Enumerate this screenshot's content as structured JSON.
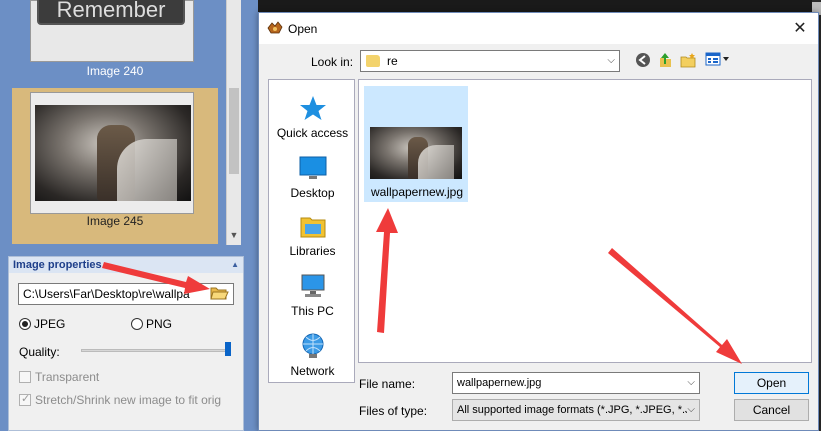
{
  "background_app": {
    "thumbnails": [
      {
        "label": "Image 240",
        "banner_text": "Remember"
      },
      {
        "label": "Image 245"
      }
    ],
    "image_properties": {
      "title": "Image properties",
      "path_value": "C:\\Users\\Far\\Desktop\\re\\wallpa",
      "format_options": [
        {
          "label": "JPEG",
          "selected": true
        },
        {
          "label": "PNG",
          "selected": false
        }
      ],
      "quality_label": "Quality:",
      "quality_level": 1.0,
      "transparent_label": "Transparent",
      "stretch_label": "Stretch/Shrink new image to fit orig"
    }
  },
  "dialog": {
    "title": "Open",
    "look_in_label": "Look in:",
    "look_in_value": "re",
    "places": [
      {
        "label": "Quick access",
        "icon": "star-icon"
      },
      {
        "label": "Desktop",
        "icon": "desktop-icon"
      },
      {
        "label": "Libraries",
        "icon": "libraries-icon"
      },
      {
        "label": "This PC",
        "icon": "computer-icon"
      },
      {
        "label": "Network",
        "icon": "network-icon"
      }
    ],
    "files": [
      {
        "name": "wallpapernew.jpg",
        "selected": true
      }
    ],
    "file_name_label": "File name:",
    "file_name_value": "wallpapernew.jpg",
    "file_type_label": "Files of type:",
    "file_type_value": "All supported image formats (*.JPG, *.JPEG, *.JI",
    "open_label": "Open",
    "cancel_label": "Cancel"
  },
  "colors": {
    "annotation_arrow": "#ef3b3b",
    "selection": "#cce8ff",
    "panel_blue": "#6c8fc5",
    "selected_thumb": "#d8b97c",
    "accent": "#0078d7"
  }
}
